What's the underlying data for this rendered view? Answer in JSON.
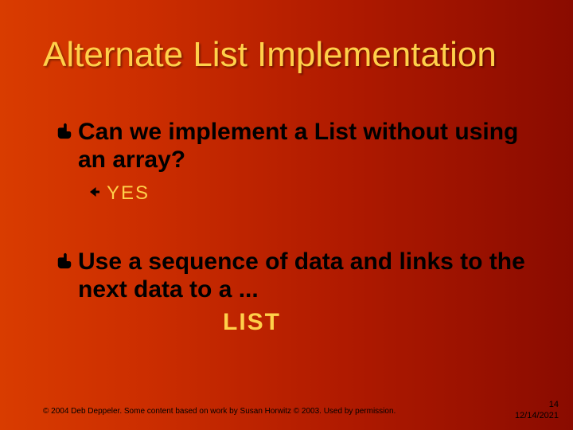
{
  "title": "Alternate List Implementation",
  "bullets": {
    "b1": "Can we implement a List without using an array?",
    "b1_sub": "YES",
    "b2": "Use a sequence of data and links to the next data to a ...",
    "b2_list": "LIST"
  },
  "footer": {
    "credit": "© 2004 Deb Deppeler.  Some content based on work by Susan Horwitz © 2003.  Used by permission.",
    "page": "14",
    "date": "12/14/2021"
  }
}
